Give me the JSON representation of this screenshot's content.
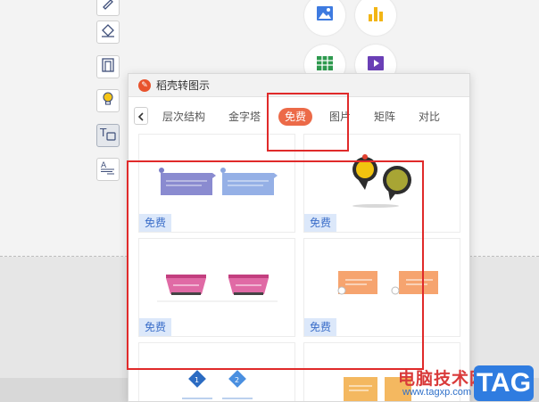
{
  "panel": {
    "logo_glyph": "✎",
    "title": "稻壳转图示"
  },
  "tabs": [
    {
      "label": "层次结构"
    },
    {
      "label": "金字塔"
    },
    {
      "label": "免费",
      "active": true
    },
    {
      "label": "图片"
    },
    {
      "label": "矩阵"
    },
    {
      "label": "对比"
    }
  ],
  "cards": [
    {
      "badge": "免费"
    },
    {
      "badge": "免费"
    },
    {
      "badge": "免费"
    },
    {
      "badge": "免费"
    }
  ],
  "watermark": {
    "site": "电脑技术网",
    "url": "www.tagxp.com",
    "tag": "TAG"
  },
  "colors": {
    "accent": "#ec6a48",
    "badge_bg": "#dce8fa",
    "badge_text": "#3b6ec9",
    "annotation_red": "#e02a2a"
  }
}
